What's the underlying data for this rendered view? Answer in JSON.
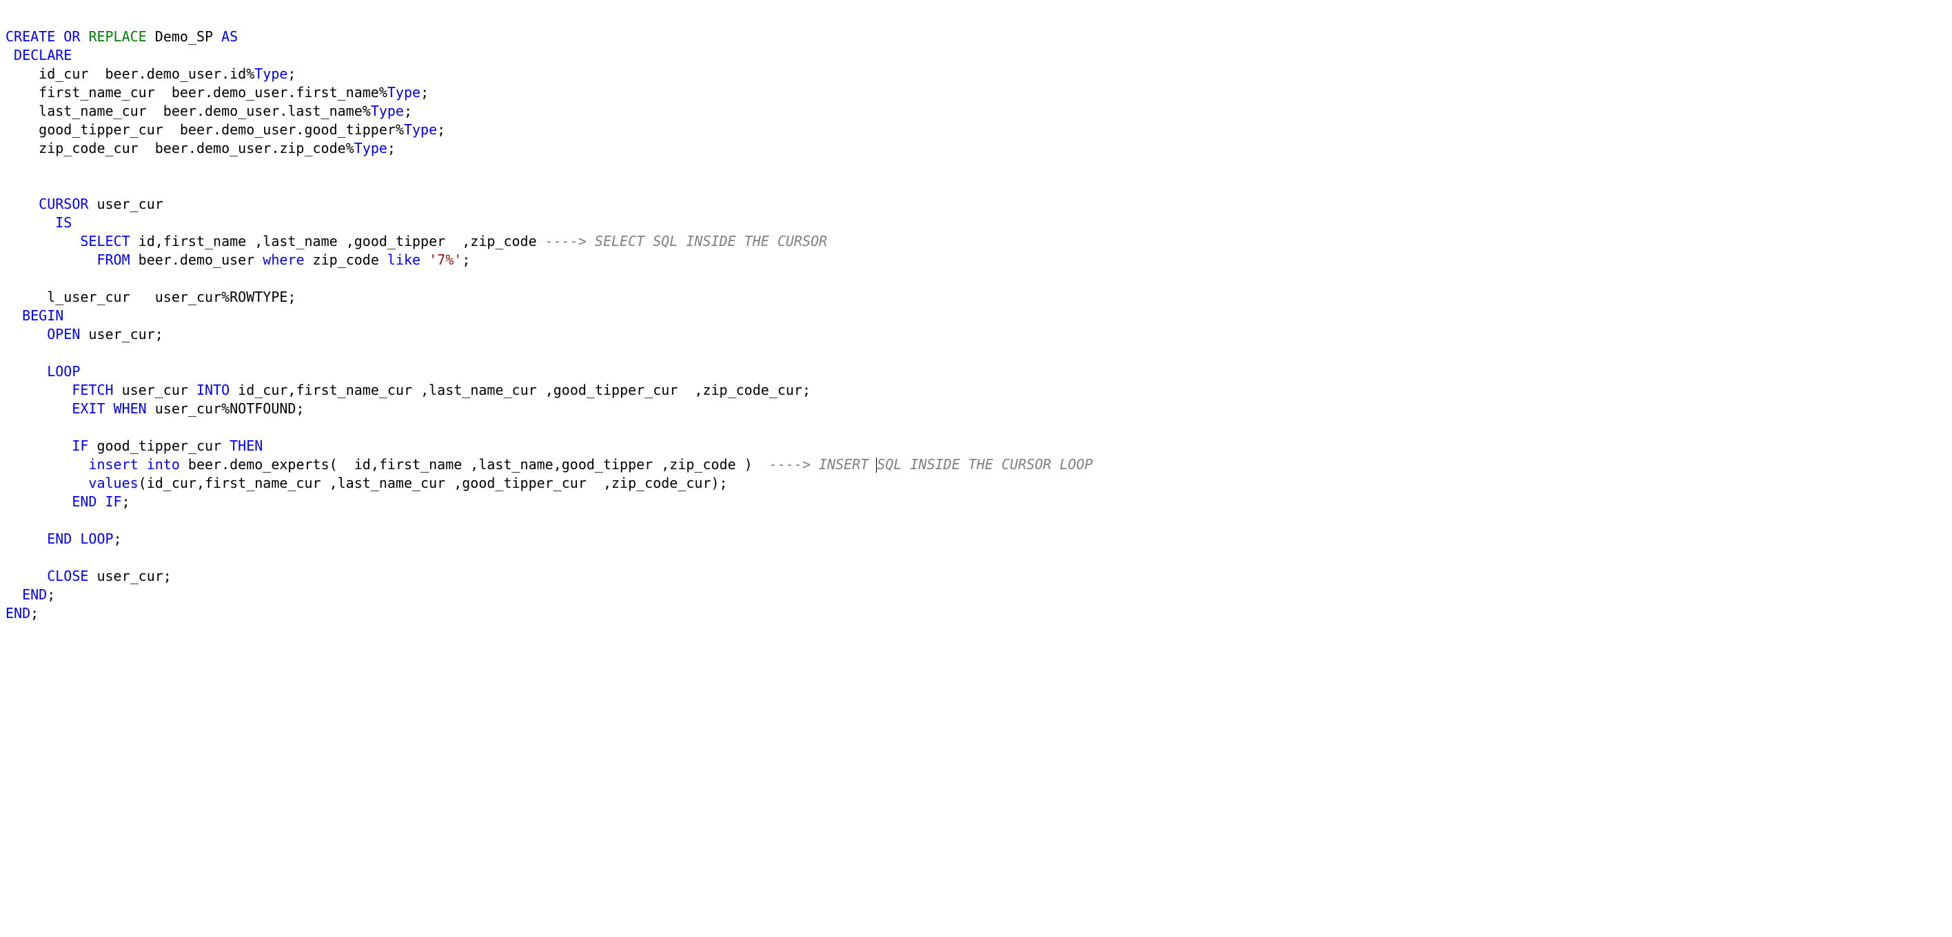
{
  "tokens": {
    "t01": "CREATE",
    "t02": "OR",
    "t03": "REPLACE",
    "t04": " Demo_SP ",
    "t05": "AS",
    "t06": " DECLARE",
    "t07": "    id_cur  beer.demo_user.id%",
    "t08": "Type",
    "t09": ";",
    "t10": "    first_name_cur  beer.demo_user.first_name%",
    "t11": "    last_name_cur  beer.demo_user.last_name%",
    "t12": "    good_tipper_cur  beer.demo_user.good_tipper%",
    "t13": "    zip_code_cur  beer.demo_user.zip_code%",
    "t14": "    CURSOR",
    "t15": " user_cur",
    "t16": "      IS",
    "t17": "         SELECT",
    "t18": " id,first_name ,last_name ,good_tipper  ,zip_code ",
    "t19": "----> SELECT SQL INSIDE THE CURSOR",
    "t20": "           FROM",
    "t21": " beer.demo_user ",
    "t22": "where",
    "t23": " zip_code ",
    "t24": "like",
    "t25": " ",
    "t26": "'7%'",
    "t27": "     l_user_cur   user_cur%ROWTYPE;",
    "t28": "  BEGIN",
    "t29": "     OPEN",
    "t30": " user_cur;",
    "t31": "     LOOP",
    "t32": "        FETCH",
    "t33": " user_cur ",
    "t34": "INTO",
    "t35": " id_cur,first_name_cur ,last_name_cur ,good_tipper_cur  ,zip_code_cur;",
    "t36": "        EXIT",
    "t37": "WHEN",
    "t38": " user_cur%NOTFOUND;",
    "t39": "        IF",
    "t40": " good_tipper_cur ",
    "t41": "THEN",
    "t42": "          insert",
    "t43": "into",
    "t44": " beer.demo_experts(  id,first_name ,last_name,good_tipper ,zip_code )  ",
    "t45a": "----> INSERT ",
    "t45b": "SQL INSIDE THE CURSOR LOOP",
    "t46": "          values",
    "t47": "(id_cur,first_name_cur ,last_name_cur ,good_tipper_cur  ,zip_code_cur);",
    "t48": "        END",
    "t49": "IF",
    "t50": "     END",
    "t51": "LOOP",
    "t52": "     CLOSE",
    "t53": "  END",
    "t54": "END",
    "sp": " ",
    "semi": ";"
  }
}
